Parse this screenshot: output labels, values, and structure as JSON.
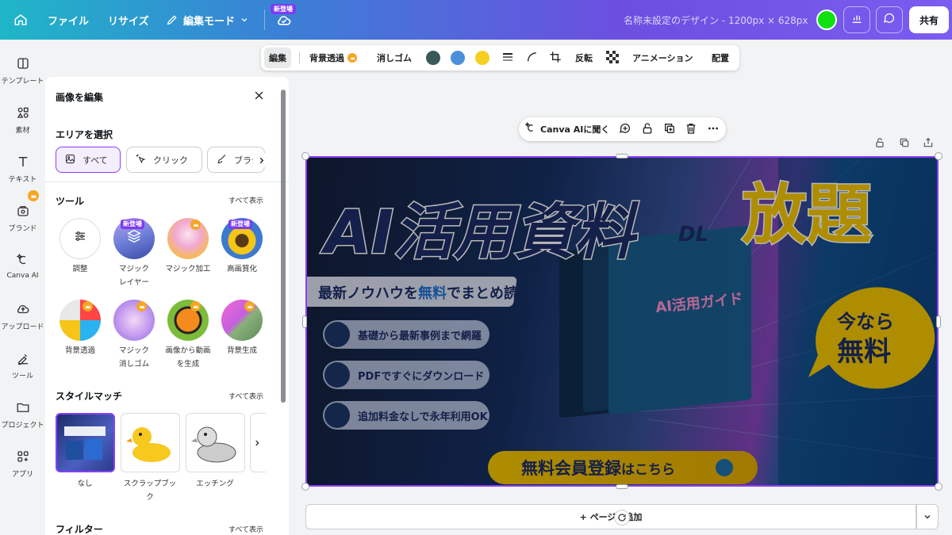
{
  "topbar": {
    "home_icon": "home-icon",
    "file_label": "ファイル",
    "resize_label": "リサイズ",
    "edit_mode_label": "編集モード",
    "new_badge": "新登場",
    "design_title": "名称未設定のデザイン - 1200px × 628px",
    "share_label": "共有",
    "avatar_color": "#10e010"
  },
  "rail": {
    "items": [
      {
        "label": "テンプレート",
        "icon": "template-icon"
      },
      {
        "label": "素材",
        "icon": "elements-icon"
      },
      {
        "label": "テキスト",
        "icon": "text-icon"
      },
      {
        "label": "ブランド",
        "icon": "brand-icon"
      },
      {
        "label": "Canva AI",
        "icon": "canva-ai-icon"
      },
      {
        "label": "アップロード",
        "icon": "upload-icon"
      },
      {
        "label": "ツール",
        "icon": "tools-icon"
      },
      {
        "label": "プロジェクト",
        "icon": "projects-icon"
      },
      {
        "label": "アプリ",
        "icon": "apps-icon"
      }
    ]
  },
  "panel": {
    "title": "画像を編集",
    "area_heading": "エリアを選択",
    "area_chips": [
      "すべて",
      "クリック",
      "ブラシ"
    ],
    "tools_heading": "ツール",
    "see_all": "すべて表示",
    "tools": [
      {
        "label": "調整",
        "badge": ""
      },
      {
        "label": "マジック\nレイヤー",
        "badge": "新登場"
      },
      {
        "label": "マジック加工",
        "badge": "crown"
      },
      {
        "label": "高画質化",
        "badge": "新登場"
      },
      {
        "label": "背景透過",
        "badge": "crown"
      },
      {
        "label": "マジック\n消しゴム",
        "badge": "crown"
      },
      {
        "label": "画像から動画\nを生成",
        "badge": "crown"
      },
      {
        "label": "背景生成",
        "badge": "crown"
      }
    ],
    "style_heading": "スタイルマッチ",
    "styles": [
      {
        "label": "なし"
      },
      {
        "label": "スクラップブッ\nク"
      },
      {
        "label": "エッチング"
      }
    ],
    "filter_heading": "フィルター"
  },
  "toolbar": {
    "edit": "編集",
    "bg_remove": "背景透過",
    "eraser": "消しゴム",
    "colors": [
      "#3a5a5a",
      "#4a90d9",
      "#f5d020"
    ],
    "flip": "反転",
    "animation": "アニメーション",
    "position": "配置"
  },
  "ai_bar": {
    "label": "Canva AIに聞く"
  },
  "canvas": {
    "headline_1": "AI活用資料",
    "headline_dl": "DL",
    "headline_2": "放題",
    "subtitle_a": "最新ノウハウを",
    "subtitle_b": "無料",
    "subtitle_c": "でまとめ読み",
    "features": [
      "基礎から最新事例まで網羅",
      "PDFですぐにダウンロード",
      "追加料金なしで永年利用OK"
    ],
    "book_title": "AI活用ガイド",
    "bubble_1": "今なら",
    "bubble_2": "無料",
    "cta_a": "無料会員登録",
    "cta_b": "はこちら"
  },
  "add_page": {
    "label": "+ ページを追加"
  }
}
